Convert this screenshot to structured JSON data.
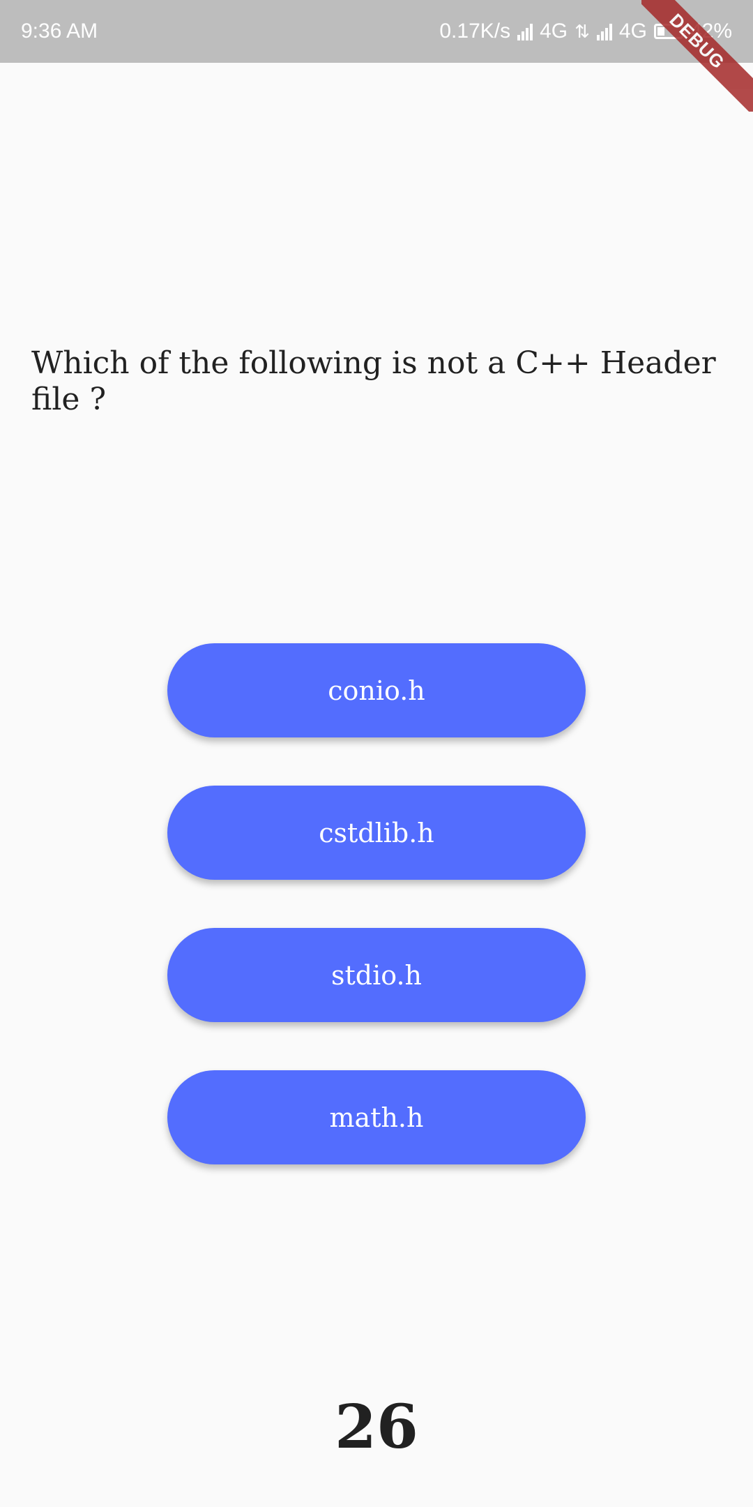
{
  "status_bar": {
    "time": "9:36 AM",
    "network_speed": "0.17K/s",
    "network_1": "4G",
    "network_2": "4G",
    "battery": "42%"
  },
  "debug_banner": "DEBUG",
  "question": "Which of the following is not a C++ Header file ?",
  "options": [
    "conio.h",
    "cstdlib.h",
    "stdio.h",
    "math.h"
  ],
  "score": "26",
  "colors": {
    "button": "#536dfe",
    "status_bar": "#bdbdbd",
    "background": "#fafafa"
  }
}
